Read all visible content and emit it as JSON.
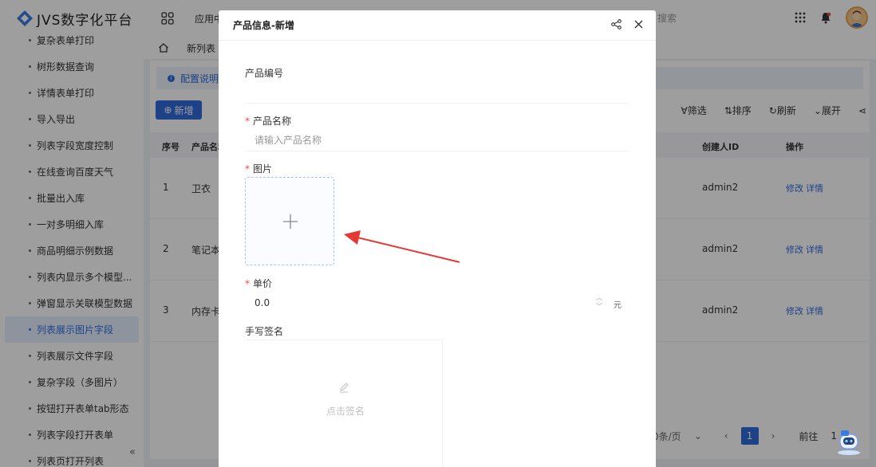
{
  "header": {
    "logo_text": "JVS数字化平台",
    "app_menu": "应用中",
    "search_placeholder": "搜索"
  },
  "sidebar": {
    "items": [
      {
        "label": "复杂表单打印"
      },
      {
        "label": "树形数据查询"
      },
      {
        "label": "详情表单打印"
      },
      {
        "label": "导入导出"
      },
      {
        "label": "列表字段宽度控制"
      },
      {
        "label": "在线查询百度天气"
      },
      {
        "label": "批量出入库"
      },
      {
        "label": "一对多明细入库"
      },
      {
        "label": "商品明细示例数据"
      },
      {
        "label": "列表内显示多个模型..."
      },
      {
        "label": "弹窗显示关联模型数据"
      },
      {
        "label": "列表展示图片字段"
      },
      {
        "label": "列表展示文件字段"
      },
      {
        "label": "复杂字段（多图片）"
      },
      {
        "label": "按钮打开表单tab形态"
      },
      {
        "label": "列表字段打开表单"
      },
      {
        "label": "列表页打开列表"
      }
    ],
    "active_index": 11,
    "collapse_label": "«"
  },
  "main": {
    "tab_label": "新列表",
    "config_label": "配置说明",
    "add_button": "新增",
    "toolbar": {
      "filter": "筛选",
      "sort": "排序",
      "refresh": "刷新",
      "expand": "展开"
    },
    "table": {
      "headers": {
        "index": "序号",
        "name": "产品名称",
        "creator": "创建人ID",
        "actions": "操作"
      },
      "rows": [
        {
          "index": "1",
          "name": "卫衣",
          "creator": "admin2",
          "edit": "修改",
          "detail": "详情"
        },
        {
          "index": "2",
          "name": "笔记本",
          "creator": "admin2",
          "edit": "修改",
          "detail": "详情"
        },
        {
          "index": "3",
          "name": "内存卡",
          "creator": "admin2",
          "edit": "修改",
          "detail": "详情"
        }
      ]
    },
    "pager": {
      "page_size": "0条/页",
      "current": "1",
      "goto_label": "前往",
      "goto_value": "1"
    }
  },
  "dialog": {
    "title": "产品信息-新增",
    "fields": {
      "code_label": "产品编号",
      "code_value": "",
      "name_label": "产品名称",
      "name_placeholder": "请输入产品名称",
      "image_label": "图片",
      "price_label": "单价",
      "price_value": "0.0",
      "price_unit": "元",
      "signature_label": "手写签名",
      "signature_hint": "点击签名"
    },
    "required_mark": "*"
  },
  "colors": {
    "primary": "#2f6bdb",
    "required": "#e34d4d",
    "annotation_arrow": "#e53935"
  }
}
